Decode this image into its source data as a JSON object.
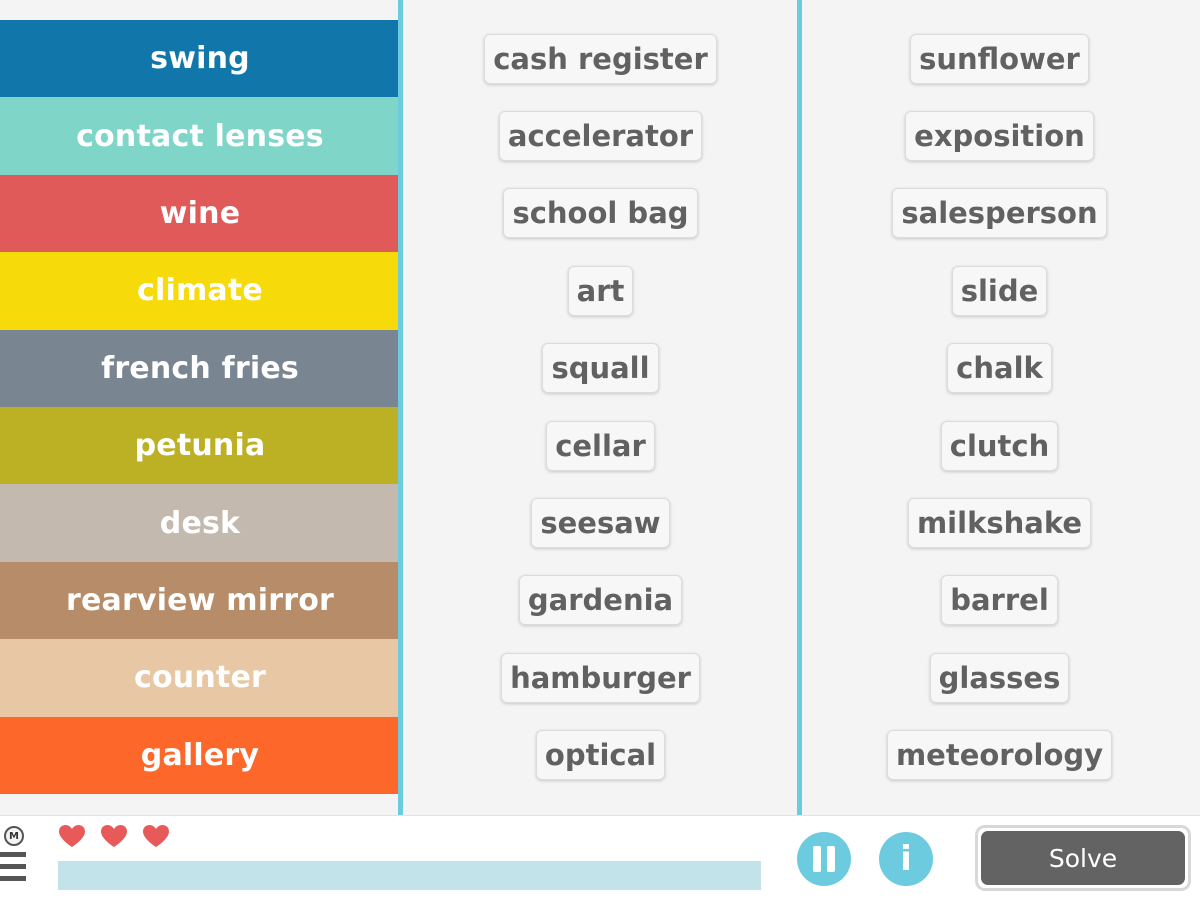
{
  "categories": [
    {
      "label": "swing",
      "color": "#1177ab"
    },
    {
      "label": "contact lenses",
      "color": "#7fd5c8"
    },
    {
      "label": "wine",
      "color": "#e05a5a"
    },
    {
      "label": "climate",
      "color": "#f7da0a"
    },
    {
      "label": "french fries",
      "color": "#7a8592"
    },
    {
      "label": "petunia",
      "color": "#bcb024"
    },
    {
      "label": "desk",
      "color": "#c4b9ae"
    },
    {
      "label": "rearview mirror",
      "color": "#b78c69"
    },
    {
      "label": "counter",
      "color": "#e8c7a5"
    },
    {
      "label": "gallery",
      "color": "#fe672a"
    }
  ],
  "column_middle": [
    "cash register",
    "accelerator",
    "school bag",
    "art",
    "squall",
    "cellar",
    "seesaw",
    "gardenia",
    "hamburger",
    "optical"
  ],
  "column_right": [
    "sunflower",
    "exposition",
    "salesperson",
    "slide",
    "chalk",
    "clutch",
    "milkshake",
    "barrel",
    "glasses",
    "meteorology"
  ],
  "footer": {
    "menu_badge": "M",
    "lives": 3,
    "progress_fraction": 0,
    "pause_icon": "pause-icon",
    "info_label": "i",
    "solve_label": "Solve"
  },
  "colors": {
    "accent": "#6dcbe0",
    "heart": "#e85a5a",
    "progress_track": "#c3e3ea",
    "solve_button": "#636363"
  }
}
